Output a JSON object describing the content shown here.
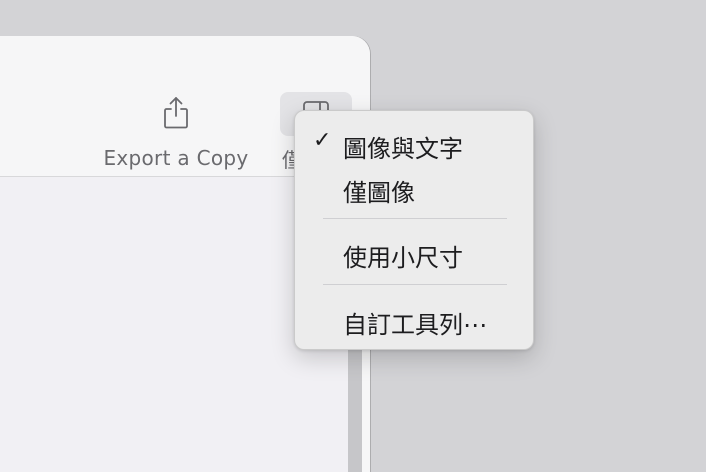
{
  "toolbar": {
    "export_label": "Export a Copy",
    "view_label": "僅"
  },
  "menu": {
    "items": [
      {
        "label": "圖像與文字",
        "checked": true,
        "check_glyph": "✓"
      },
      {
        "label": "僅圖像",
        "checked": false
      },
      {
        "label": "使用小尺寸",
        "checked": false
      },
      {
        "label": "自訂工具列⋯",
        "checked": false
      }
    ]
  },
  "icons": {
    "export": "share-icon",
    "view": "sidebar-view-icon"
  },
  "colors": {
    "desktop": "#d3d3d6",
    "window": "#f6f6f7",
    "menu_bg": "#ececec",
    "text": "#1d1d1f",
    "toolbar_text": "#6a6a6e"
  }
}
